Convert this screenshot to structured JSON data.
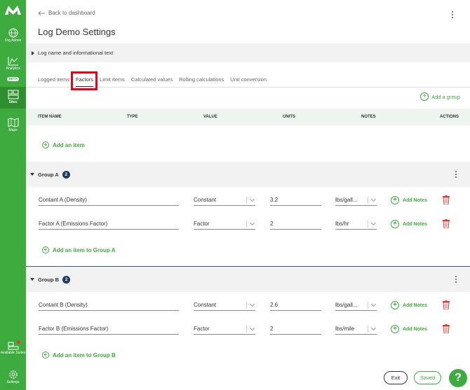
{
  "sidebar": {
    "org_admin": "Org Admin",
    "analytics": "Analytics",
    "beta": "BETA",
    "sites": "Sites",
    "maps": "Maps",
    "available_suites": "Available Suites",
    "settings": "Settings"
  },
  "header": {
    "back_label": "Back to dashboard",
    "title": "Log Demo Settings"
  },
  "collapse_section": {
    "label": "Log name and informational text"
  },
  "tabs": [
    {
      "label": "Logged items"
    },
    {
      "label": "Factors"
    },
    {
      "label": "Limit items"
    },
    {
      "label": "Calculated values"
    },
    {
      "label": "Rolling calculations"
    },
    {
      "label": "Unit conversion"
    }
  ],
  "active_tab": "Factors",
  "add_group_label": "Add a group",
  "table_headers": {
    "item_name": "ITEM NAME",
    "type": "TYPE",
    "value": "VALUE",
    "units": "UNITS",
    "notes": "NOTES",
    "actions": "ACTIONS"
  },
  "add_item_label": "Add an item",
  "groups": [
    {
      "name": "Group A",
      "count": "2",
      "items": [
        {
          "name": "Contant A (Density)",
          "type": "Constant",
          "value": "3.2",
          "units": "lbs/gall...",
          "notes_label": "Add Notes"
        },
        {
          "name": "Factor A (Emissions Factor)",
          "type": "Factor",
          "value": "2",
          "units": "lbs/hr",
          "notes_label": "Add Notes"
        }
      ],
      "add_item_label": "Add an item to Group A"
    },
    {
      "name": "Group B",
      "count": "2",
      "items": [
        {
          "name": "Contant B (Density)",
          "type": "Constant",
          "value": "2.6",
          "units": "lbs/gall...",
          "notes_label": "Add Notes"
        },
        {
          "name": "Factor B (Emissions Factor)",
          "type": "Factor",
          "value": "2",
          "units": "lbs/mile",
          "notes_label": "Add Notes"
        }
      ],
      "add_item_label": "Add an item to Group B"
    }
  ],
  "footer": {
    "exit_label": "Exit",
    "saved_label": "Saved",
    "help_label": "?"
  },
  "colors": {
    "brand_green": "#3dab3d",
    "highlight_red": "#e30613",
    "badge_navy": "#1e3a5f",
    "delete_red": "#e53935"
  }
}
